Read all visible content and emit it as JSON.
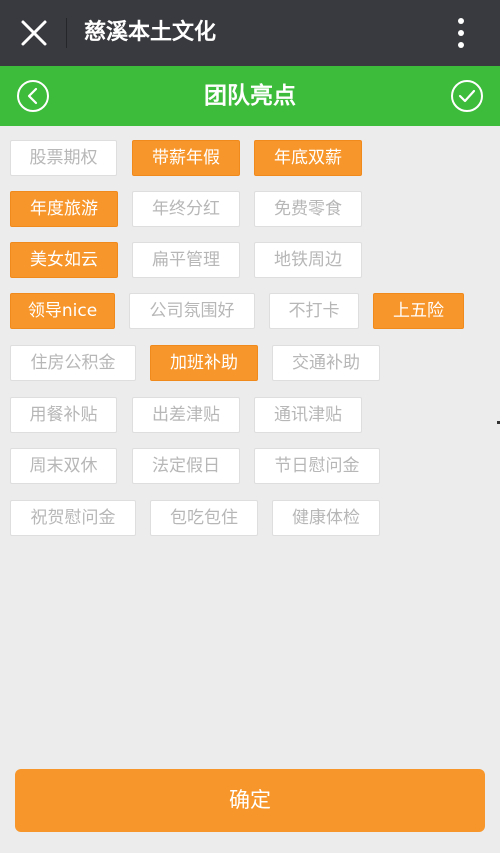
{
  "header": {
    "title": "慈溪本土文化"
  },
  "subheader": {
    "title": "团队亮点"
  },
  "tags": [
    {
      "label": "股票期权",
      "selected": false
    },
    {
      "label": "带薪年假",
      "selected": true
    },
    {
      "label": "年底双薪",
      "selected": true
    },
    {
      "label": "年度旅游",
      "selected": true
    },
    {
      "label": "年终分红",
      "selected": false
    },
    {
      "label": "免费零食",
      "selected": false
    },
    {
      "label": "美女如云",
      "selected": true
    },
    {
      "label": "扁平管理",
      "selected": false
    },
    {
      "label": "地铁周边",
      "selected": false
    },
    {
      "label": "领导nice",
      "selected": true
    },
    {
      "label": "公司氛围好",
      "selected": false
    },
    {
      "label": "不打卡",
      "selected": false
    },
    {
      "label": "上五险",
      "selected": true
    },
    {
      "label": "住房公积金",
      "selected": false
    },
    {
      "label": "加班补助",
      "selected": true
    },
    {
      "label": "交通补助",
      "selected": false
    },
    {
      "label": "用餐补贴",
      "selected": false
    },
    {
      "label": "出差津贴",
      "selected": false
    },
    {
      "label": "通讯津贴",
      "selected": false
    },
    {
      "label": "周末双休",
      "selected": false
    },
    {
      "label": "法定假日",
      "selected": false
    },
    {
      "label": "节日慰问金",
      "selected": false
    },
    {
      "label": "祝贺慰问金",
      "selected": false
    },
    {
      "label": "包吃包住",
      "selected": false
    },
    {
      "label": "健康体检",
      "selected": false
    }
  ],
  "footer": {
    "confirm_label": "确定"
  },
  "colors": {
    "topbar": "#393a3f",
    "greenbar": "#3dbb3b",
    "accent": "#f7962a",
    "background": "#ececec"
  }
}
